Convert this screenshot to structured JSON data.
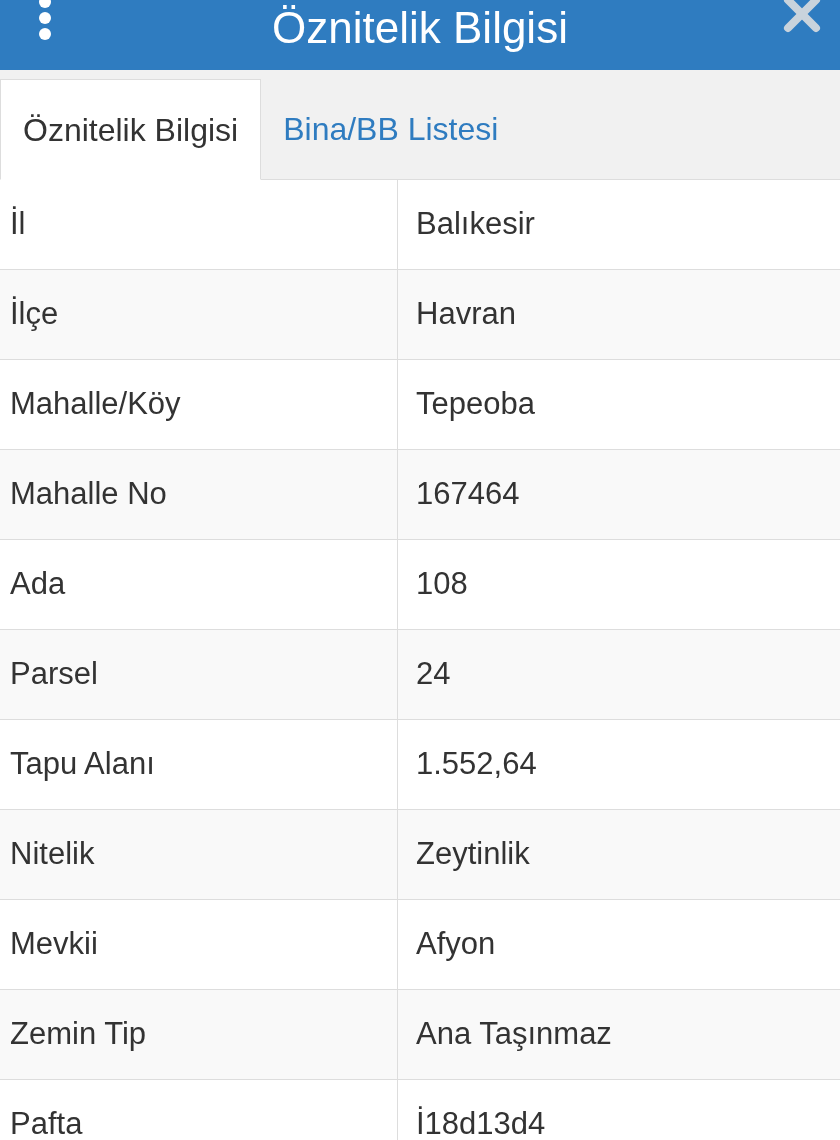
{
  "header": {
    "title": "Öznitelik Bilgisi"
  },
  "tabs": [
    {
      "label": "Öznitelik Bilgisi",
      "selected": true
    },
    {
      "label": "Bina/BB Listesi",
      "selected": false
    }
  ],
  "table": {
    "rows": [
      {
        "label": "İl",
        "value": "Balıkesir"
      },
      {
        "label": "İlçe",
        "value": "Havran"
      },
      {
        "label": "Mahalle/Köy",
        "value": "Tepeoba"
      },
      {
        "label": "Mahalle No",
        "value": "167464"
      },
      {
        "label": "Ada",
        "value": "108"
      },
      {
        "label": "Parsel",
        "value": "24"
      },
      {
        "label": "Tapu Alanı",
        "value": "1.552,64"
      },
      {
        "label": "Nitelik",
        "value": "Zeytinlik"
      },
      {
        "label": "Mevkii",
        "value": "Afyon"
      },
      {
        "label": "Zemin Tip",
        "value": "Ana Taşınmaz"
      },
      {
        "label": "Pafta",
        "value": "İ18d13d4"
      }
    ]
  }
}
